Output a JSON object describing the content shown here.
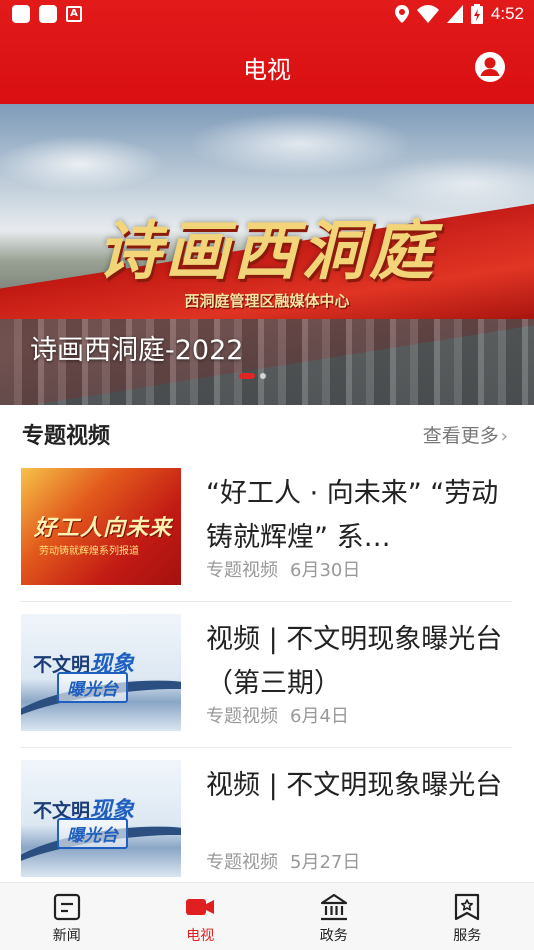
{
  "status_bar": {
    "time": "4:52",
    "app_badge": "A"
  },
  "header": {
    "title": "电视"
  },
  "banner": {
    "artwork_title": "诗画西洞庭",
    "artwork_subtitle": "西洞庭管理区融媒体中心",
    "caption": "诗画西洞庭-2022",
    "slide_count": 2,
    "active_slide": 1
  },
  "section": {
    "title": "专题视频",
    "more_label": "查看更多",
    "more_chevron": "›"
  },
  "items": [
    {
      "title": "“好工人 · 向未来” “劳动铸就辉煌” 系…",
      "category": "专题视频",
      "date": "6月30日",
      "thumb_text": "好工人向未来",
      "thumb_subtext": "劳动铸就辉煌系列报道"
    },
    {
      "title": "视频 | 不文明现象曝光台（第三期）",
      "category": "专题视频",
      "date": "6月4日",
      "thumb_text_a": "不文明",
      "thumb_text_b": "现象",
      "thumb_text_c": "曝光台"
    },
    {
      "title": "视频 | 不文明现象曝光台",
      "category": "专题视频",
      "date": "5月27日",
      "thumb_text_a": "不文明",
      "thumb_text_b": "现象",
      "thumb_text_c": "曝光台"
    }
  ],
  "bottom_nav": [
    {
      "label": "新闻",
      "icon": "news-icon",
      "active": false
    },
    {
      "label": "电视",
      "icon": "tv-camera-icon",
      "active": true
    },
    {
      "label": "政务",
      "icon": "government-icon",
      "active": false
    },
    {
      "label": "服务",
      "icon": "service-icon",
      "active": false
    }
  ],
  "colors": {
    "brand_red": "#e02020",
    "header_red": "#dc1515",
    "muted_text": "#999999"
  }
}
